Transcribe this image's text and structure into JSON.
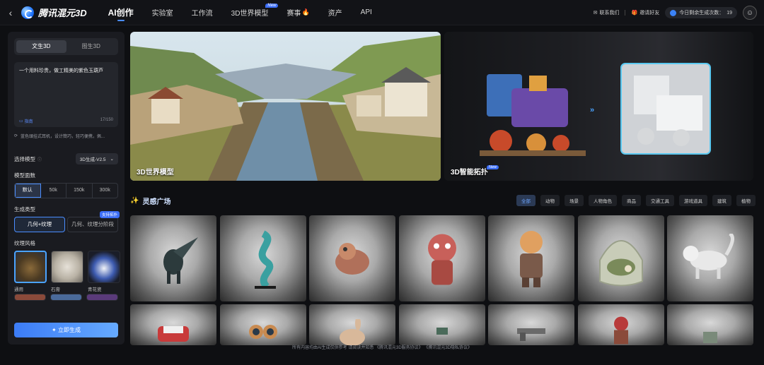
{
  "topbar": {
    "brand": "腾讯混元3D",
    "nav": [
      {
        "label": "AI创作",
        "active": true
      },
      {
        "label": "实验室"
      },
      {
        "label": "工作流"
      },
      {
        "label": "3D世界模型",
        "badge": "New"
      },
      {
        "label": "赛事"
      },
      {
        "label": "资产"
      },
      {
        "label": "API"
      }
    ],
    "contact": "联系我们",
    "invite": "邀请好友",
    "quota_label": "今日剩余生成次数：",
    "quota_value": "19"
  },
  "panel": {
    "modes": [
      "文生3D",
      "图生3D"
    ],
    "prompt_text": "一个用料珍贵，做工精美的紫色玉葫芦",
    "guide_label": "指南",
    "char_count": "17/150",
    "suggest_text": "蓝色頭挂式耳机，设计簡巧，轻巧便携，佩...",
    "model_label": "选择模型",
    "model_value": "3D生成-V2.5",
    "faces_label": "模型面数",
    "faces_options": [
      "默认",
      "50k",
      "150k",
      "300k"
    ],
    "gen_type_label": "生成类型",
    "gen_types": [
      "几何+纹理",
      "几何、纹理分阶段"
    ],
    "gen_badge": "支持拓扑",
    "texture_label": "纹理风格",
    "textures": [
      "通用",
      "石膏",
      "青花瓷"
    ],
    "generate_label": "立即生成"
  },
  "banners": [
    {
      "title": "3D世界模型"
    },
    {
      "title": "3D智能拓扑",
      "badge": "New"
    }
  ],
  "inspiration": {
    "title": "灵感广场",
    "filters": [
      "全部",
      "动物",
      "场景",
      "人物角色",
      "商品",
      "交通工具",
      "游戏道具",
      "建筑",
      "植物"
    ]
  },
  "footer": "所有内容均由AI生成仅供参考 请阅读并知悉 《腾讯混元3D服务协议》 《腾讯混元3D隐私协议》",
  "colors": {
    "accent": "#4a8dff",
    "bg": "#0e0f12",
    "panel": "#1a1b20"
  }
}
